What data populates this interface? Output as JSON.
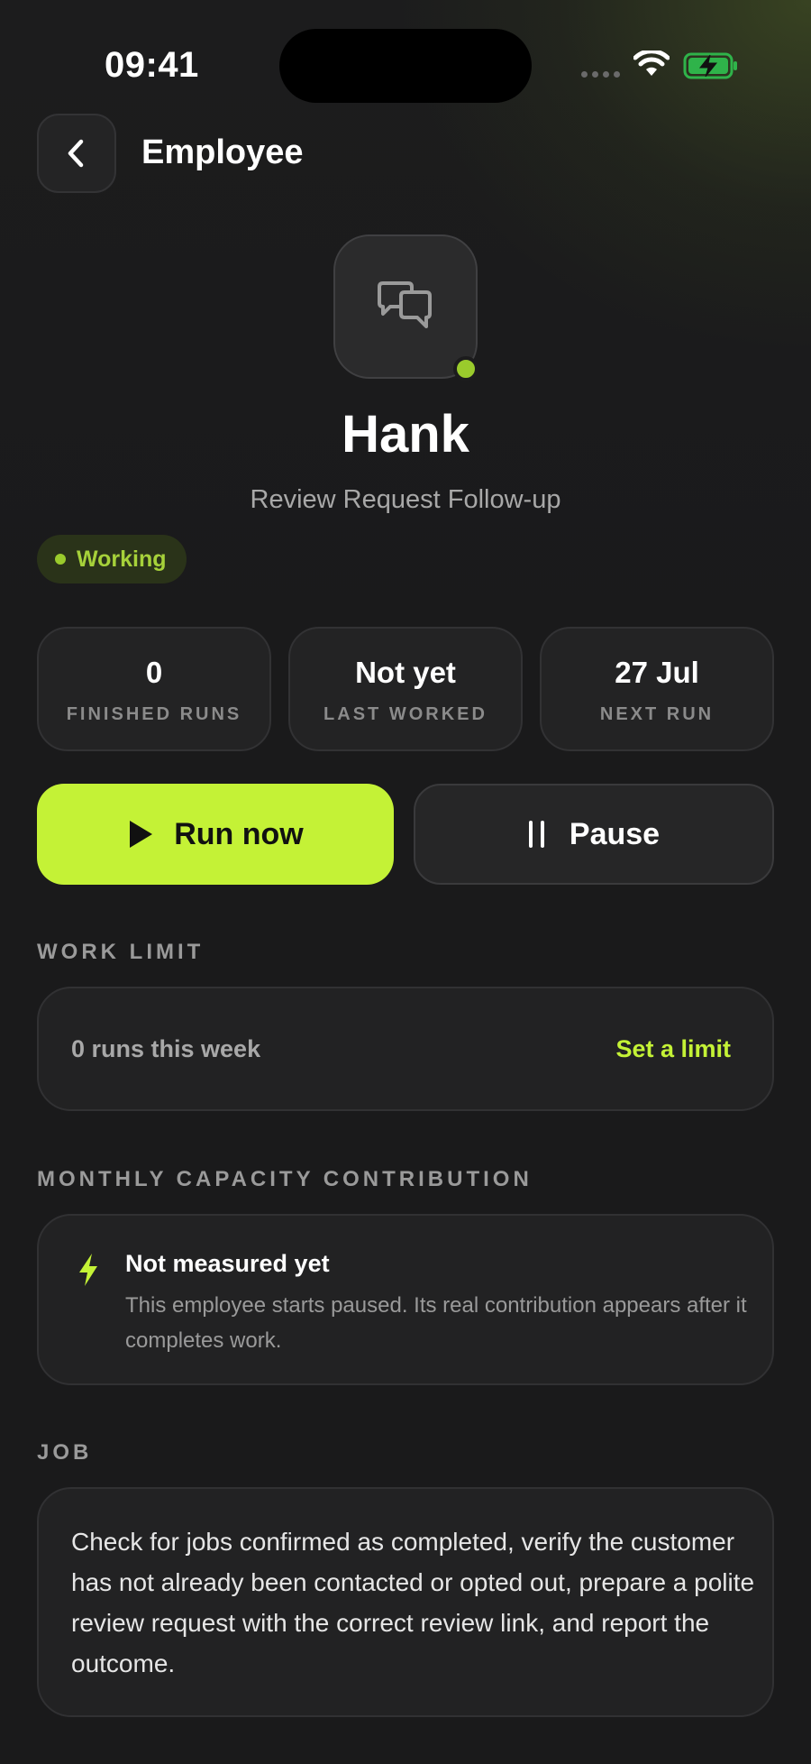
{
  "status_bar": {
    "time": "09:41"
  },
  "header": {
    "title": "Employee"
  },
  "employee": {
    "name": "Hank",
    "role": "Review Request Follow-up",
    "status": "Working"
  },
  "stats": [
    {
      "value": "0",
      "label": "FINISHED RUNS"
    },
    {
      "value": "Not yet",
      "label": "LAST WORKED"
    },
    {
      "value": "27 Jul",
      "label": "NEXT RUN"
    }
  ],
  "actions": {
    "run_label": "Run now",
    "pause_label": "Pause"
  },
  "work_limit": {
    "heading": "WORK LIMIT",
    "summary": "0 runs this week",
    "link": "Set a limit"
  },
  "capacity": {
    "heading": "MONTHLY CAPACITY CONTRIBUTION",
    "title": "Not measured yet",
    "description": "This employee starts paused. Its real contribution appears after it completes work."
  },
  "job": {
    "heading": "JOB",
    "description": "Check for jobs confirmed as completed, verify the customer has not already been contacted or opted out, prepare a polite review request with the correct review link, and report the outcome."
  },
  "colors": {
    "accent": "#c4f236",
    "status_green": "#9acb2c",
    "background": "#1a1a1b"
  },
  "icons": {
    "back": "chevron-left-icon",
    "avatar": "chat-bubbles-icon",
    "run": "play-icon",
    "pause": "pause-icon",
    "capacity": "lightning-icon"
  }
}
